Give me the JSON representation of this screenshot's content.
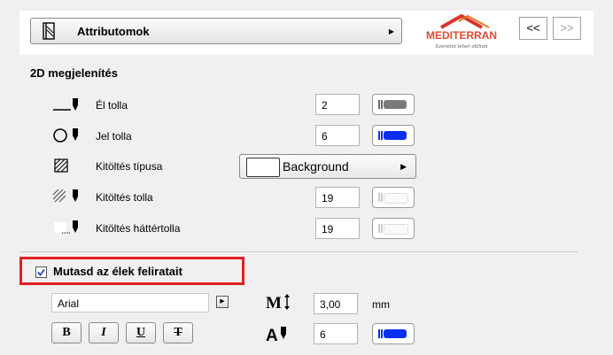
{
  "header": {
    "attributes_label": "Attributomok",
    "logo_text": "MEDITERRAN",
    "logo_tagline": "Szeretni lehet otthon",
    "prev_label": "<<",
    "next_label": ">>"
  },
  "section": {
    "title": "2D megjelenítés"
  },
  "rows": [
    {
      "label": "Él tolla",
      "value": "2"
    },
    {
      "label": "Jel tolla",
      "value": "6"
    },
    {
      "label": "Kitöltés típusa",
      "value": "Background"
    },
    {
      "label": "Kitöltés tolla",
      "value": "19"
    },
    {
      "label": "Kitöltés háttértolla",
      "value": "19"
    }
  ],
  "labels_option": {
    "checkbox_label": "Mutasd az élek feliratait",
    "checked": true,
    "font": "Arial",
    "size_value": "3,00",
    "size_unit": "mm",
    "text_pen_value": "6",
    "bold_label": "B",
    "italic_label": "I",
    "underline_label": "U",
    "strike_label": "T"
  },
  "colors": {
    "accent_blue": "#0a2ff0",
    "highlight_red": "#e32020",
    "pen_gray": "#7a7a7a"
  }
}
